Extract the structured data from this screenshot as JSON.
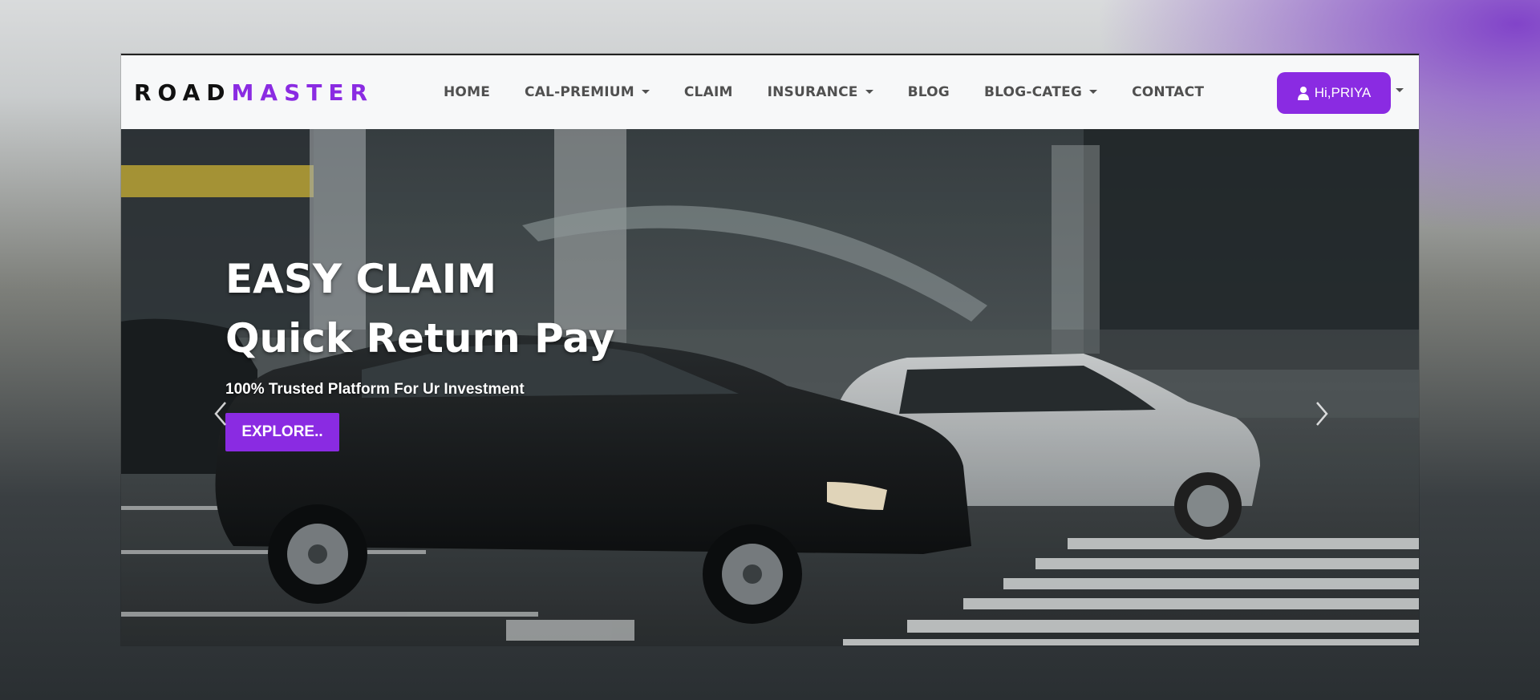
{
  "navbar": {
    "brand_part1": "ROAD",
    "brand_part2": "MASTER",
    "items": [
      {
        "label": "HOME",
        "dropdown": false
      },
      {
        "label": "CAL-PREMIUM",
        "dropdown": true
      },
      {
        "label": "CLAIM",
        "dropdown": false
      },
      {
        "label": "INSURANCE",
        "dropdown": true
      },
      {
        "label": "BLOG",
        "dropdown": false
      },
      {
        "label": "BLOG-CATEG",
        "dropdown": true
      },
      {
        "label": "CONTACT",
        "dropdown": false
      }
    ],
    "user_label": "Hi,PRIYA",
    "user_icon": "user-icon"
  },
  "hero": {
    "title": "EASY CLAIM",
    "subtitle": "Quick Return Pay",
    "text": "100% Trusted Platform For Ur Investment",
    "button_label": "EXPLORE..",
    "prev_icon": "chevron-left-icon",
    "next_icon": "chevron-right-icon"
  },
  "colors": {
    "accent": "#8a2be2",
    "nav_text": "#505050",
    "navbar_bg": "#f7f8f9"
  }
}
